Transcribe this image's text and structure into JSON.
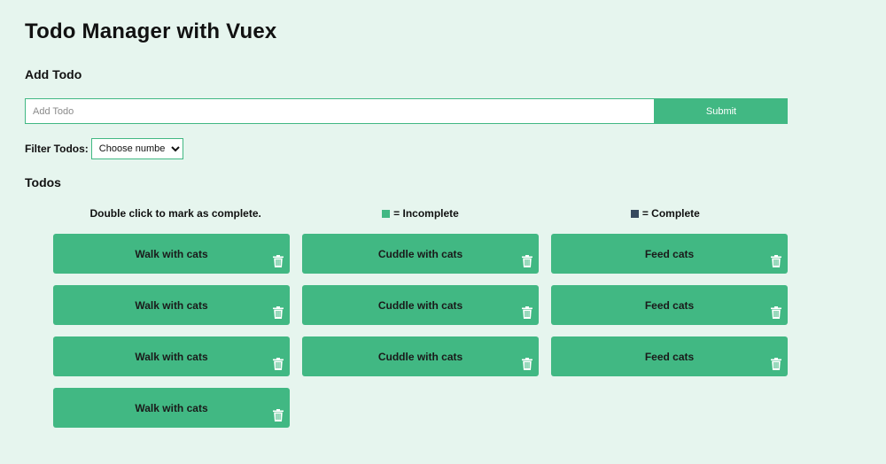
{
  "header": {
    "title": "Todo Manager with Vuex"
  },
  "add_todo": {
    "title": "Add Todo",
    "input_placeholder": "Add Todo",
    "input_value": "",
    "submit_label": "Submit"
  },
  "filter": {
    "label": "Filter Todos:",
    "selected": "Choose number"
  },
  "todos_section": {
    "title": "Todos",
    "hint": "Double click to mark as complete.",
    "legend": [
      {
        "label": "= Incomplete",
        "color": "#41b883"
      },
      {
        "label": "= Complete",
        "color": "#35495e"
      }
    ]
  },
  "colors": {
    "background": "#e6f5ee",
    "accent": "#41b883",
    "complete": "#35495e"
  },
  "todos": [
    {
      "title": "Walk with cats",
      "completed": false,
      "icon": "trash-icon"
    },
    {
      "title": "Cuddle with cats",
      "completed": false,
      "icon": "trash-icon"
    },
    {
      "title": "Feed cats",
      "completed": false,
      "icon": "trash-icon"
    },
    {
      "title": "Walk with cats",
      "completed": false,
      "icon": "trash-icon"
    },
    {
      "title": "Cuddle with cats",
      "completed": false,
      "icon": "trash-icon"
    },
    {
      "title": "Feed cats",
      "completed": false,
      "icon": "trash-icon"
    },
    {
      "title": "Walk with cats",
      "completed": false,
      "icon": "trash-icon"
    },
    {
      "title": "Cuddle with cats",
      "completed": false,
      "icon": "trash-icon"
    },
    {
      "title": "Feed cats",
      "completed": false,
      "icon": "trash-icon"
    },
    {
      "title": "Walk with cats",
      "completed": false,
      "icon": "trash-icon"
    }
  ]
}
